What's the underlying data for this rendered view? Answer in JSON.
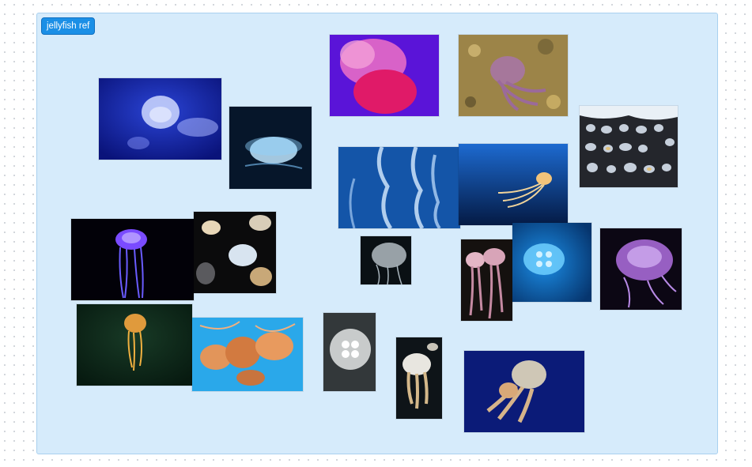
{
  "board": {
    "frame_label": "jellyfish ref",
    "colors": {
      "frame_fill": "#d6ebfb",
      "frame_border": "#a9d0ef",
      "label_fill": "#1b8fe6"
    }
  },
  "images": [
    {
      "id": "moon-jellies-blue",
      "subject": "moon-jelly"
    },
    {
      "id": "moon-jelly-glowing",
      "subject": "moon-jelly"
    },
    {
      "id": "pink-jelly-purple-bg",
      "subject": "pink-jelly"
    },
    {
      "id": "purple-jelly-sand",
      "subject": "mauve-stinger"
    },
    {
      "id": "jellyfish-species-chart",
      "subject": "chart"
    },
    {
      "id": "comb-jelly-tentacles",
      "subject": "tentacles"
    },
    {
      "id": "sea-nettle-deep-blue",
      "subject": "sea-nettle"
    },
    {
      "id": "purple-jelly-black",
      "subject": "purple-jelly"
    },
    {
      "id": "spotted-jellies-black",
      "subject": "spotted-jelly"
    },
    {
      "id": "moon-jelly-dark",
      "subject": "moon-jelly"
    },
    {
      "id": "pink-jellies-dark",
      "subject": "pink-jelly"
    },
    {
      "id": "moon-jelly-cyan",
      "subject": "moon-jelly"
    },
    {
      "id": "violet-jelly-black",
      "subject": "moon-jelly"
    },
    {
      "id": "orange-jelly-green",
      "subject": "orange-jelly"
    },
    {
      "id": "sea-nettles-cyan",
      "subject": "sea-nettle"
    },
    {
      "id": "moon-jelly-grey",
      "subject": "moon-jelly"
    },
    {
      "id": "white-spotted-jellies",
      "subject": "spotted-jelly"
    },
    {
      "id": "spotted-jelly-navy",
      "subject": "spotted-jelly"
    }
  ]
}
